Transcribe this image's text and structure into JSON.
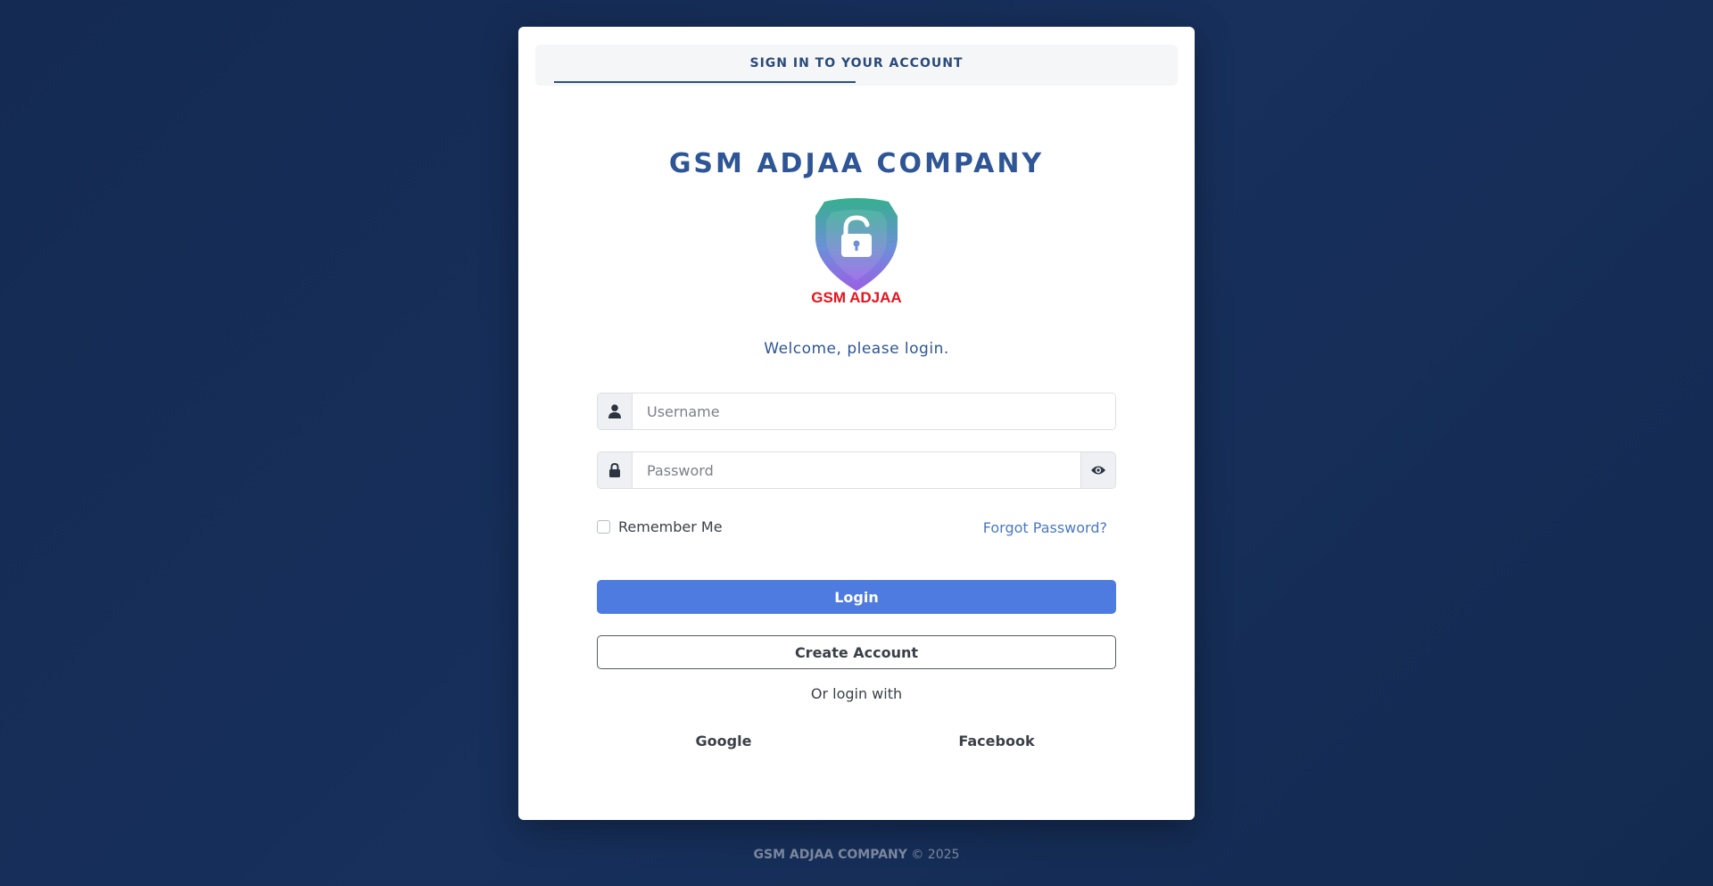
{
  "header": {
    "tab_label": "SIGN IN TO YOUR ACCOUNT"
  },
  "brand": {
    "title": "GSM ADJAA COMPANY",
    "logo_text": "GSM ADJAA",
    "logo_icon": "shield-lock-icon"
  },
  "welcome": "Welcome, please login.",
  "form": {
    "username_placeholder": "Username",
    "username_value": "",
    "username_icon": "user-icon",
    "password_placeholder": "Password",
    "password_value": "",
    "password_icon": "lock-icon",
    "toggle_icon": "eye-icon",
    "remember_label": "Remember Me",
    "remember_checked": false,
    "forgot_label": "Forgot Password?",
    "login_label": "Login",
    "create_label": "Create Account"
  },
  "social": {
    "divider_text": "Or login with",
    "google_label": "Google",
    "facebook_label": "Facebook"
  },
  "footer": {
    "company": "GSM ADJAA COMPANY",
    "copyright": "© 2025"
  },
  "colors": {
    "accent": "#4d7be0",
    "brand_blue": "#2e5596",
    "link": "#4a78c4",
    "logo_red": "#e8121b",
    "background": "#142a52"
  }
}
